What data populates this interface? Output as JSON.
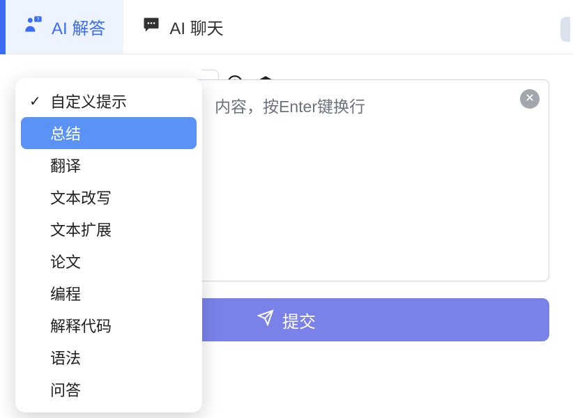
{
  "tabs": {
    "ai_answer": "AI 解答",
    "ai_chat": "AI 聊天"
  },
  "dropdown": {
    "items": [
      {
        "label": "自定义提示",
        "checked": true,
        "highlight": false
      },
      {
        "label": "总结",
        "checked": false,
        "highlight": true
      },
      {
        "label": "翻译",
        "checked": false,
        "highlight": false
      },
      {
        "label": "文本改写",
        "checked": false,
        "highlight": false
      },
      {
        "label": "文本扩展",
        "checked": false,
        "highlight": false
      },
      {
        "label": "论文",
        "checked": false,
        "highlight": false
      },
      {
        "label": "编程",
        "checked": false,
        "highlight": false
      },
      {
        "label": "解释代码",
        "checked": false,
        "highlight": false
      },
      {
        "label": "语法",
        "checked": false,
        "highlight": false
      },
      {
        "label": "问答",
        "checked": false,
        "highlight": false
      }
    ]
  },
  "editor": {
    "placeholder_visible": "内容，按Enter键换行"
  },
  "submit": {
    "label": "提交"
  }
}
